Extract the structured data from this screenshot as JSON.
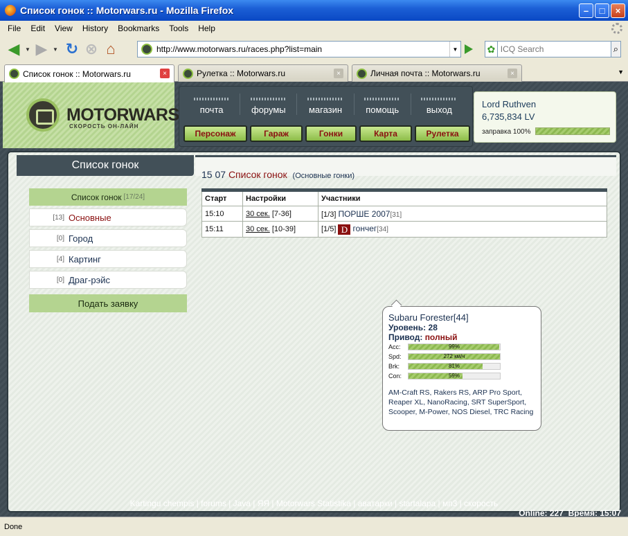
{
  "window": {
    "title": "Список гонок :: Motorwars.ru - Mozilla Firefox"
  },
  "menu": [
    "File",
    "Edit",
    "View",
    "History",
    "Bookmarks",
    "Tools",
    "Help"
  ],
  "nav": {
    "url": "http://www.motorwars.ru/races.php?list=main",
    "search_placeholder": "ICQ Search"
  },
  "tabs": [
    {
      "label": "Список гонок :: Motorwars.ru",
      "active": true
    },
    {
      "label": "Рулетка :: Motorwars.ru",
      "active": false
    },
    {
      "label": "Личная почта :: Motorwars.ru",
      "active": false
    }
  ],
  "site": {
    "logo": "MOTORWARS.RU",
    "logo_sub": "СКОРОСТЬ ОН-ЛАЙН",
    "top_links": [
      "почта",
      "форумы",
      "магазин",
      "помощь",
      "выход"
    ],
    "green_buttons": [
      "Персонаж",
      "Гараж",
      "Гонки",
      "Карта",
      "Рулетка"
    ],
    "user": {
      "name": "Lord Ruthven",
      "money": "6,735,834 LV",
      "fuel_label": "заправка 100%",
      "fuel_percent": 100
    },
    "page_title": "Список гонок",
    "sidebar": {
      "head": "Список гонок",
      "head_count": "[17/24]",
      "items": [
        {
          "count": "[13]",
          "label": "Основные",
          "active": true
        },
        {
          "count": "[0]",
          "label": "Город",
          "active": false
        },
        {
          "count": "[4]",
          "label": "Картинг",
          "active": false
        },
        {
          "count": "[0]",
          "label": "Драг-рэйс",
          "active": false
        }
      ],
      "submit": "Подать заявку"
    },
    "heading": {
      "num": "15 07",
      "title": "Список гонок",
      "sub": "(Основные гонки)"
    },
    "table": {
      "headers": [
        "Старт",
        "Настройки",
        "Участники"
      ],
      "rows": [
        {
          "start": "15:10",
          "setting_link": "30 сек.",
          "setting_range": "[7-36]",
          "slots": "[1/3]",
          "icon": "",
          "participant": "ПОРШЕ 2007",
          "level": "[31]"
        },
        {
          "start": "15:11",
          "setting_link": "30 сек.",
          "setting_range": "[10-39]",
          "slots": "[1/5]",
          "icon": "D",
          "participant": "гончег",
          "level": "[34]"
        }
      ]
    },
    "tooltip": {
      "car": "Subaru Forester[44]",
      "level": "Уровень: 28",
      "drive_label": "Привод:",
      "drive_value": "полный",
      "stats": [
        {
          "key": "Acc:",
          "value": "99%",
          "percent": 99
        },
        {
          "key": "Spd:",
          "value": "272 км/ч",
          "percent": 100
        },
        {
          "key": "Brk:",
          "value": "81%",
          "percent": 81
        },
        {
          "key": "Con:",
          "value": "59%",
          "percent": 59
        }
      ],
      "parts": "AM-Craft RS, Rakers RS, ARP Pro Sport, Reaper XL, NanoRacing, SRT SuperSport, Scooper, M-Power, NOS Diesel, TRC Racing"
    },
    "footer": {
      "links": "Kartingu chempis | forums | Java | ЯЯ | Motorwars Statistika | аватарки | startalapa | мп3 | скорость",
      "online": "Online: 227",
      "time": "Время: 15:07"
    }
  },
  "status": "Done"
}
